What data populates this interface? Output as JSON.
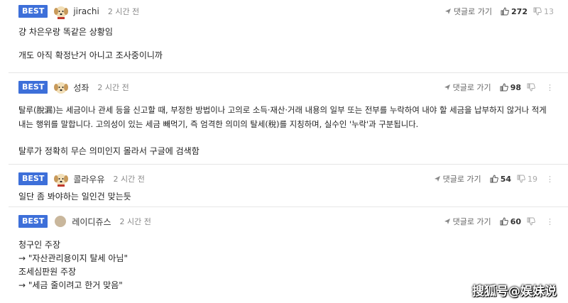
{
  "comments": [
    {
      "badge": "BEST",
      "nickname": "jirachi",
      "time": "2 시간 전",
      "reply_label": "댓글로 가기",
      "upvotes": "272",
      "downvotes": "13",
      "avatar": "dog",
      "lines": [
        "걍 차은우랑 똑같은 상황임",
        "",
        "개도 아직 확정난거 아니고 조사중이니까"
      ]
    },
    {
      "badge": "BEST",
      "nickname": "성좌",
      "time": "2 시간 전",
      "reply_label": "댓글로 가기",
      "upvotes": "98",
      "downvotes": "",
      "avatar": "dog",
      "lines": [
        "탈루(脫漏)는 세금이나 관세 등을 신고할 때, 부정한 방법이나 고의로 소득·재산·거래 내용의 일부 또는 전부를 누락하여 내야 할 세금을 납부하지 않거나 적게",
        "내는 행위를 말합니다. 고의성이 있는 세금 빼먹기, 즉 엄격한 의미의 탈세(稅)를 지칭하며, 실수인 '누락'과 구분됩니다.",
        "",
        "탈루가 정확히 무슨 의미인지 몰라서 구글에 검색함"
      ]
    },
    {
      "badge": "BEST",
      "nickname": "콜라우유",
      "time": "2 시간 전",
      "reply_label": "댓글로 가기",
      "upvotes": "54",
      "downvotes": "19",
      "avatar": "dog",
      "lines": [
        "일단 좀 봐야하는 일인건 맞는듯"
      ]
    },
    {
      "badge": "BEST",
      "nickname": "레이디쥬스",
      "time": "2 시간 전",
      "reply_label": "댓글로 가기",
      "upvotes": "60",
      "downvotes": "",
      "avatar": "plain",
      "lines": [
        "청구인 주장",
        "→ \"자산관리용이지 탈세 아님\"",
        "조세심판원 주장",
        "→ \"세금 줄이려고 한거 맞음\""
      ]
    }
  ],
  "watermark": "搜狐号@娱妹说",
  "colors": {
    "badge": "#3d6fd9"
  }
}
